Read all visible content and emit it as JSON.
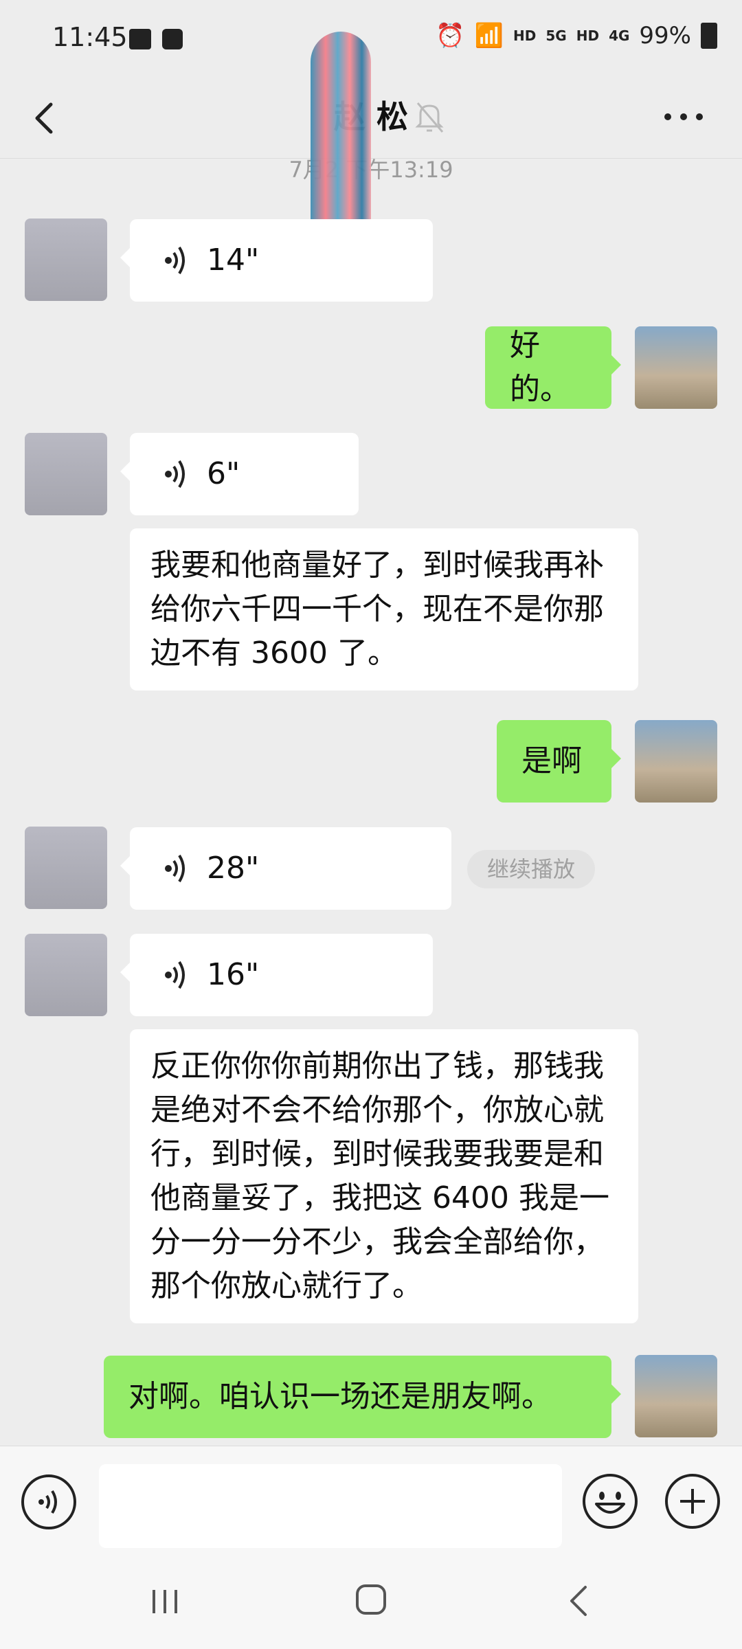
{
  "status_bar": {
    "time": "11:45",
    "labels": [
      "HD",
      "5G",
      "HD",
      "4G"
    ],
    "battery": "99%"
  },
  "header": {
    "title": "赵 松",
    "timestamp": "7月2 下午13:19"
  },
  "messages": [
    {
      "side": "in",
      "kind": "voice",
      "duration": "14\""
    },
    {
      "side": "out",
      "kind": "text",
      "text": "好的。"
    },
    {
      "side": "in",
      "kind": "voice",
      "duration": "6\""
    },
    {
      "side": "in",
      "kind": "text",
      "text": "我要和他商量好了，到时候我再补给你六千四一千个，现在不是你那边不有 3600 了。"
    },
    {
      "side": "out",
      "kind": "text",
      "text": "是啊"
    },
    {
      "side": "in",
      "kind": "voice",
      "duration": "28\"",
      "action": "继续播放"
    },
    {
      "side": "in",
      "kind": "voice",
      "duration": "16\""
    },
    {
      "side": "in",
      "kind": "text",
      "text": "反正你你你前期你出了钱，那钱我是绝对不会不给你那个，你放心就行，到时候，到时候我要我要是和他商量妥了，我把这 6400 我是一分一分一分不少，我会全部给你，那个你放心就行了。"
    },
    {
      "side": "out",
      "kind": "text",
      "text": "对啊。咱认识一场还是朋友啊。"
    }
  ],
  "colors": {
    "background": "#ededed",
    "bubble_out": "#95ec69",
    "bubble_in": "#ffffff"
  },
  "icons": [
    "back-arrow-icon",
    "mute-bell-icon",
    "more-dots-icon",
    "voice-wave-icon",
    "emoji-icon",
    "plus-icon",
    "nav-recent-icon",
    "nav-home-icon",
    "nav-back-icon"
  ]
}
